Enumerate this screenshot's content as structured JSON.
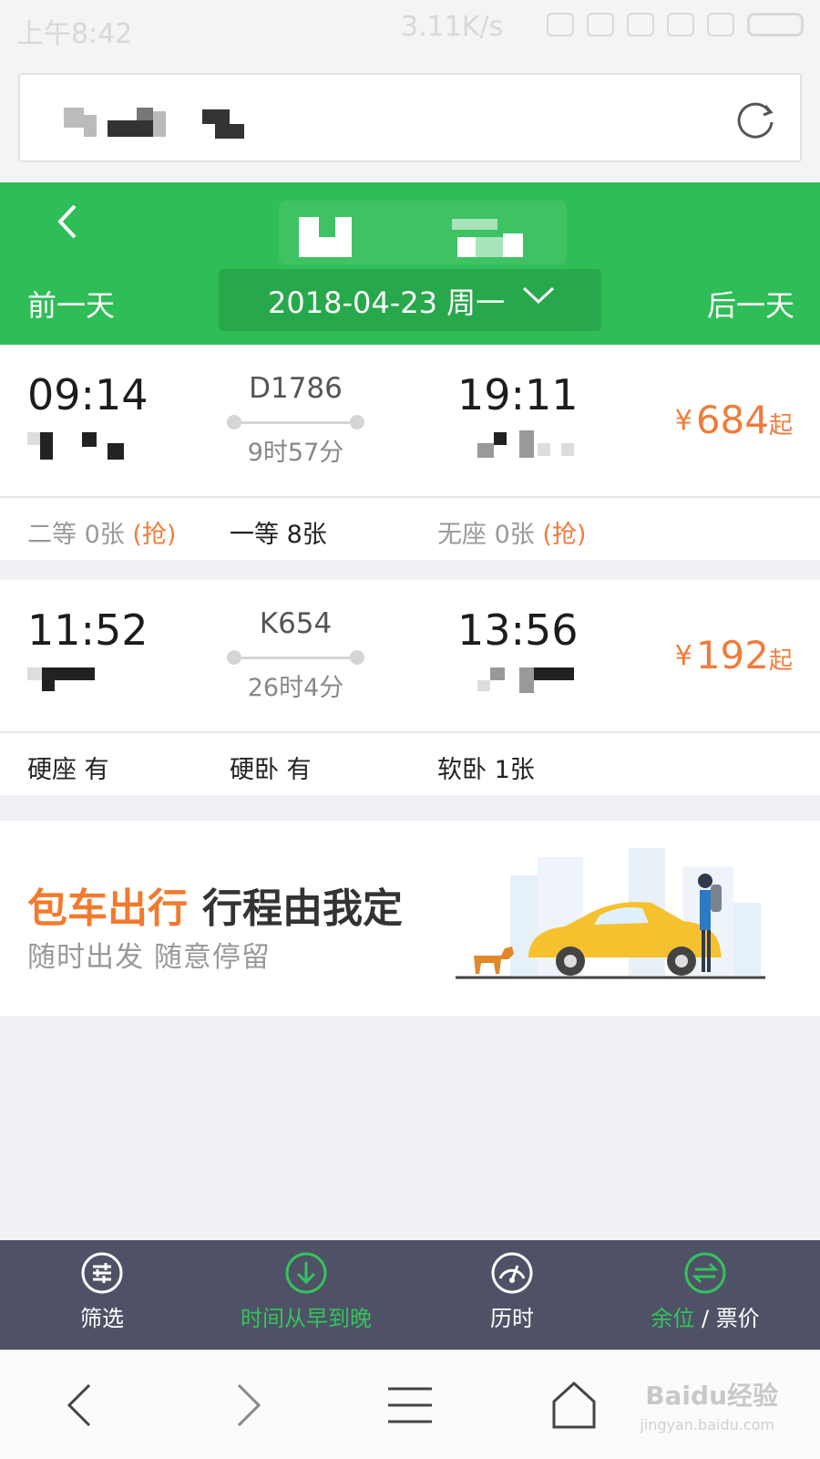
{
  "status_bar": {
    "time": "上午8:42",
    "network_speed": "3.11K/s"
  },
  "header": {
    "prev_day_label": "前一天",
    "next_day_label": "后一天",
    "date": "2018-04-23 周一"
  },
  "trains": [
    {
      "depart_time": "09:14",
      "train_no": "D1786",
      "duration": "9时57分",
      "arrive_time": "19:11",
      "price_currency": "¥",
      "price": "684",
      "price_suffix": "起",
      "seats": [
        {
          "label": "二等 0张",
          "grab": "(抢)"
        },
        {
          "label": "一等 8张",
          "grab": ""
        },
        {
          "label": "无座 0张",
          "grab": "(抢)"
        }
      ]
    },
    {
      "depart_time": "11:52",
      "train_no": "K654",
      "duration": "26时4分",
      "arrive_time": "13:56",
      "price_currency": "¥",
      "price": "192",
      "price_suffix": "起",
      "seats": [
        {
          "label": "硬座 有",
          "grab": ""
        },
        {
          "label": "硬卧 有",
          "grab": ""
        },
        {
          "label": "软卧 1张",
          "grab": ""
        }
      ]
    }
  ],
  "promo": {
    "title_highlight": "包车出行",
    "title_rest": "行程由我定",
    "subtitle": "随时出发  随意停留"
  },
  "filter_bar": {
    "filter_label": "筛选",
    "sort_time_label": "时间从早到晚",
    "duration_label": "历时",
    "seats_label": "余位",
    "separator": "/",
    "price_label": "票价"
  },
  "watermark": {
    "text": "Baidu经验",
    "sub": "jingyan.baidu.com"
  },
  "colors": {
    "header_green": "#2fbd57",
    "price_orange": "#f07c3c",
    "active_green": "#35c35d",
    "filter_bar_bg": "#4f5266"
  }
}
